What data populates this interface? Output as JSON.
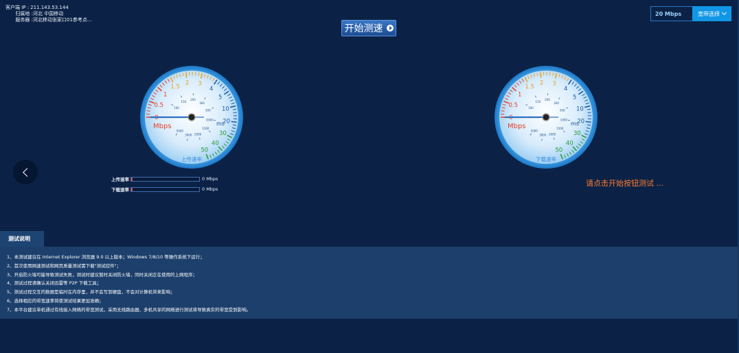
{
  "client": {
    "ip_label": "客户端 IP :",
    "ip_value": "211.143.53.144",
    "location_label": "归属地 :",
    "location_value": "河北 中国移动",
    "server_label": "服务器 :",
    "server_value": "河北移动张家口01参考点..."
  },
  "start_button": {
    "label": "开始测速"
  },
  "bandwidth": {
    "value": "20 Mbps",
    "button_label": "宽带选择"
  },
  "gauges": {
    "upload": {
      "name": "上传速率",
      "unit_speed": "Mbps",
      "unit_ping": "ms",
      "outer_ticks": [
        "0",
        "0.5",
        "1",
        "1.5",
        "2",
        "3",
        "4",
        "5",
        "10",
        "20",
        "30",
        "40",
        "50"
      ],
      "inner_ticks": [
        "100",
        "150",
        "200",
        "300",
        "500",
        "1000",
        "1500",
        "2000",
        "3000",
        "5000"
      ]
    },
    "download": {
      "name": "下载速率",
      "unit_speed": "Mbps",
      "unit_ping": "ms",
      "outer_ticks": [
        "0",
        "0.5",
        "1",
        "1.5",
        "2",
        "3",
        "4",
        "5",
        "10",
        "20",
        "30",
        "40",
        "50"
      ],
      "inner_ticks": [
        "100",
        "150",
        "200",
        "300",
        "500",
        "1000",
        "1500",
        "2000",
        "3000",
        "5000"
      ]
    }
  },
  "rates": {
    "upload": {
      "label": "上传速率",
      "value": "0 Mbps",
      "progress": 0
    },
    "download": {
      "label": "下载速率",
      "value": "0 Mbps",
      "progress": 0
    }
  },
  "hint": "请点击开始按钮测试 ...",
  "notes": {
    "tab_label": "测试说明",
    "items": [
      "1、本测试建议在 Internet Explorer 浏览器 9.0 以上版本；Windows 7/8/10 等操作系统下运行；",
      "2、首次使用网速测试和网页质量测试需下载\"测试控件\"；",
      "3、开启防火墙可能导致测试失败，测试时建议暂时关闭防火墙，同时关闭正在使用的上网程序；",
      "4、测试过程请确认关闭迅雷等 P2P 下载工具；",
      "5、测试过程交互的数据是临时在内存里，并不会写到硬盘，不会对计算机带来影响；",
      "6、选择相应的带宽速率将使测试结果更加准确；",
      "7、本平台建议单机通过有线接入网络的带宽测试，采用无线路由器、多机共享的网络进行测试将导致真实的带宽受到影响。"
    ]
  },
  "colors": {
    "background": "#0b2246",
    "accent": "#1297e6",
    "hint": "#ff7b2e",
    "panel": "#1c3f6c"
  }
}
